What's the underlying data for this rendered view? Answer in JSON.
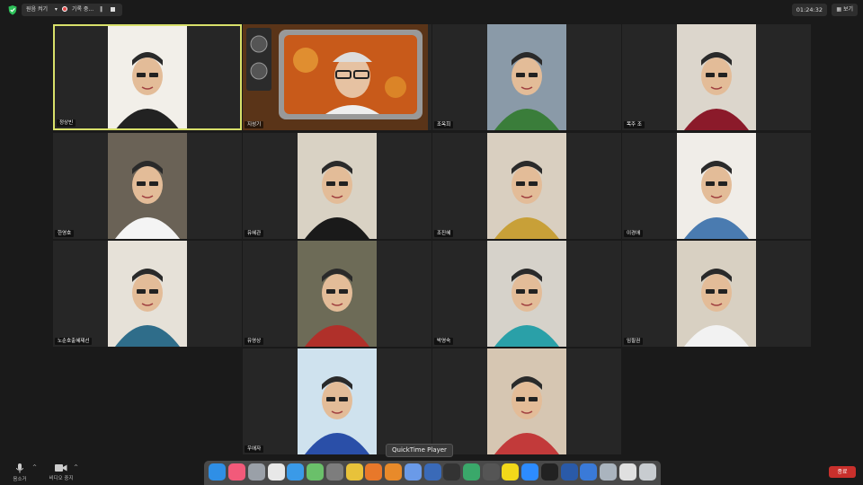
{
  "topbar": {
    "original_sound_label": "원음 켜기",
    "recording_label": "기록 중...",
    "recording_pause_icon": "pause-icon",
    "recording_stop_icon": "stop-icon",
    "timer": "01:24:32",
    "view_label": "보기"
  },
  "participants": [
    {
      "name": "정상빈",
      "bg": "#f2efe9",
      "shirt": "#222",
      "active": true
    },
    {
      "name": "지성기",
      "bg": "#6a3b1a",
      "shirt": "#eee",
      "tv_frame": true
    },
    {
      "name": "조옥희",
      "bg": "#8a9aa8",
      "shirt": "#3a7d3a"
    },
    {
      "name": "목주 조",
      "bg": "#dcd6cc",
      "shirt": "#8b1a2a"
    },
    {
      "name": "한영호",
      "bg": "#6a6256",
      "shirt": "#f4f4f4"
    },
    {
      "name": "유혜관",
      "bg": "#d9d2c4",
      "shirt": "#1a1a1a"
    },
    {
      "name": "조진혜",
      "bg": "#d9cfc0",
      "shirt": "#c8a038"
    },
    {
      "name": "이경애",
      "bg": "#f0ede8",
      "shirt": "#4a7bb0"
    },
    {
      "name": "노순호출혜제선",
      "bg": "#e6e1d8",
      "shirt": "#2f6d8a"
    },
    {
      "name": "유영상",
      "bg": "#6d6b57",
      "shirt": "#b0302a"
    },
    {
      "name": "박영숙",
      "bg": "#d6d2ca",
      "shirt": "#2aa0a8"
    },
    {
      "name": "임필권",
      "bg": "#d8d0c2",
      "shirt": "#f2f2f2"
    },
    {
      "name": "우애자",
      "bg": "#cfe2ee",
      "shirt": "#2a4fa8"
    },
    {
      "name": "",
      "bg": "#d6c6b2",
      "shirt": "#c23a3a"
    }
  ],
  "bottombar": {
    "mute_label": "음소거",
    "video_label": "비디오 중지",
    "end_label": "종료"
  },
  "dock": {
    "tooltip": "QuickTime Player",
    "apps": [
      {
        "name": "finder-icon",
        "color": "#2f8fe6"
      },
      {
        "name": "music-icon",
        "color": "#f25a7a"
      },
      {
        "name": "launchpad-icon",
        "color": "#9aa0a8"
      },
      {
        "name": "apps-grid-icon",
        "color": "#e8e8e8"
      },
      {
        "name": "safari-icon",
        "color": "#3a9ae8"
      },
      {
        "name": "maps-icon",
        "color": "#6ac06a"
      },
      {
        "name": "settings-icon",
        "color": "#7d7d7d"
      },
      {
        "name": "chrome-icon",
        "color": "#e8c23a"
      },
      {
        "name": "firefox-icon",
        "color": "#e8782a"
      },
      {
        "name": "pages-icon",
        "color": "#e88a2a"
      },
      {
        "name": "notes-icon",
        "color": "#6a9ae8"
      },
      {
        "name": "quicktime-icon",
        "color": "#3a6ab8"
      },
      {
        "name": "obs-icon",
        "color": "#333333"
      },
      {
        "name": "drive-icon",
        "color": "#3aa86a"
      },
      {
        "name": "cassette-icon",
        "color": "#555555"
      },
      {
        "name": "kakaotalk-icon",
        "color": "#f2d81a"
      },
      {
        "name": "zoom-icon",
        "color": "#2d8cff"
      },
      {
        "name": "camera-icon",
        "color": "#222222"
      },
      {
        "name": "word-icon",
        "color": "#2a5aa8"
      },
      {
        "name": "store-icon",
        "color": "#3a7ad8"
      },
      {
        "name": "preview-icon",
        "color": "#aab4be"
      },
      {
        "name": "documents-icon",
        "color": "#e0e0e0"
      },
      {
        "name": "trash-icon",
        "color": "#c8ccd0"
      }
    ]
  }
}
